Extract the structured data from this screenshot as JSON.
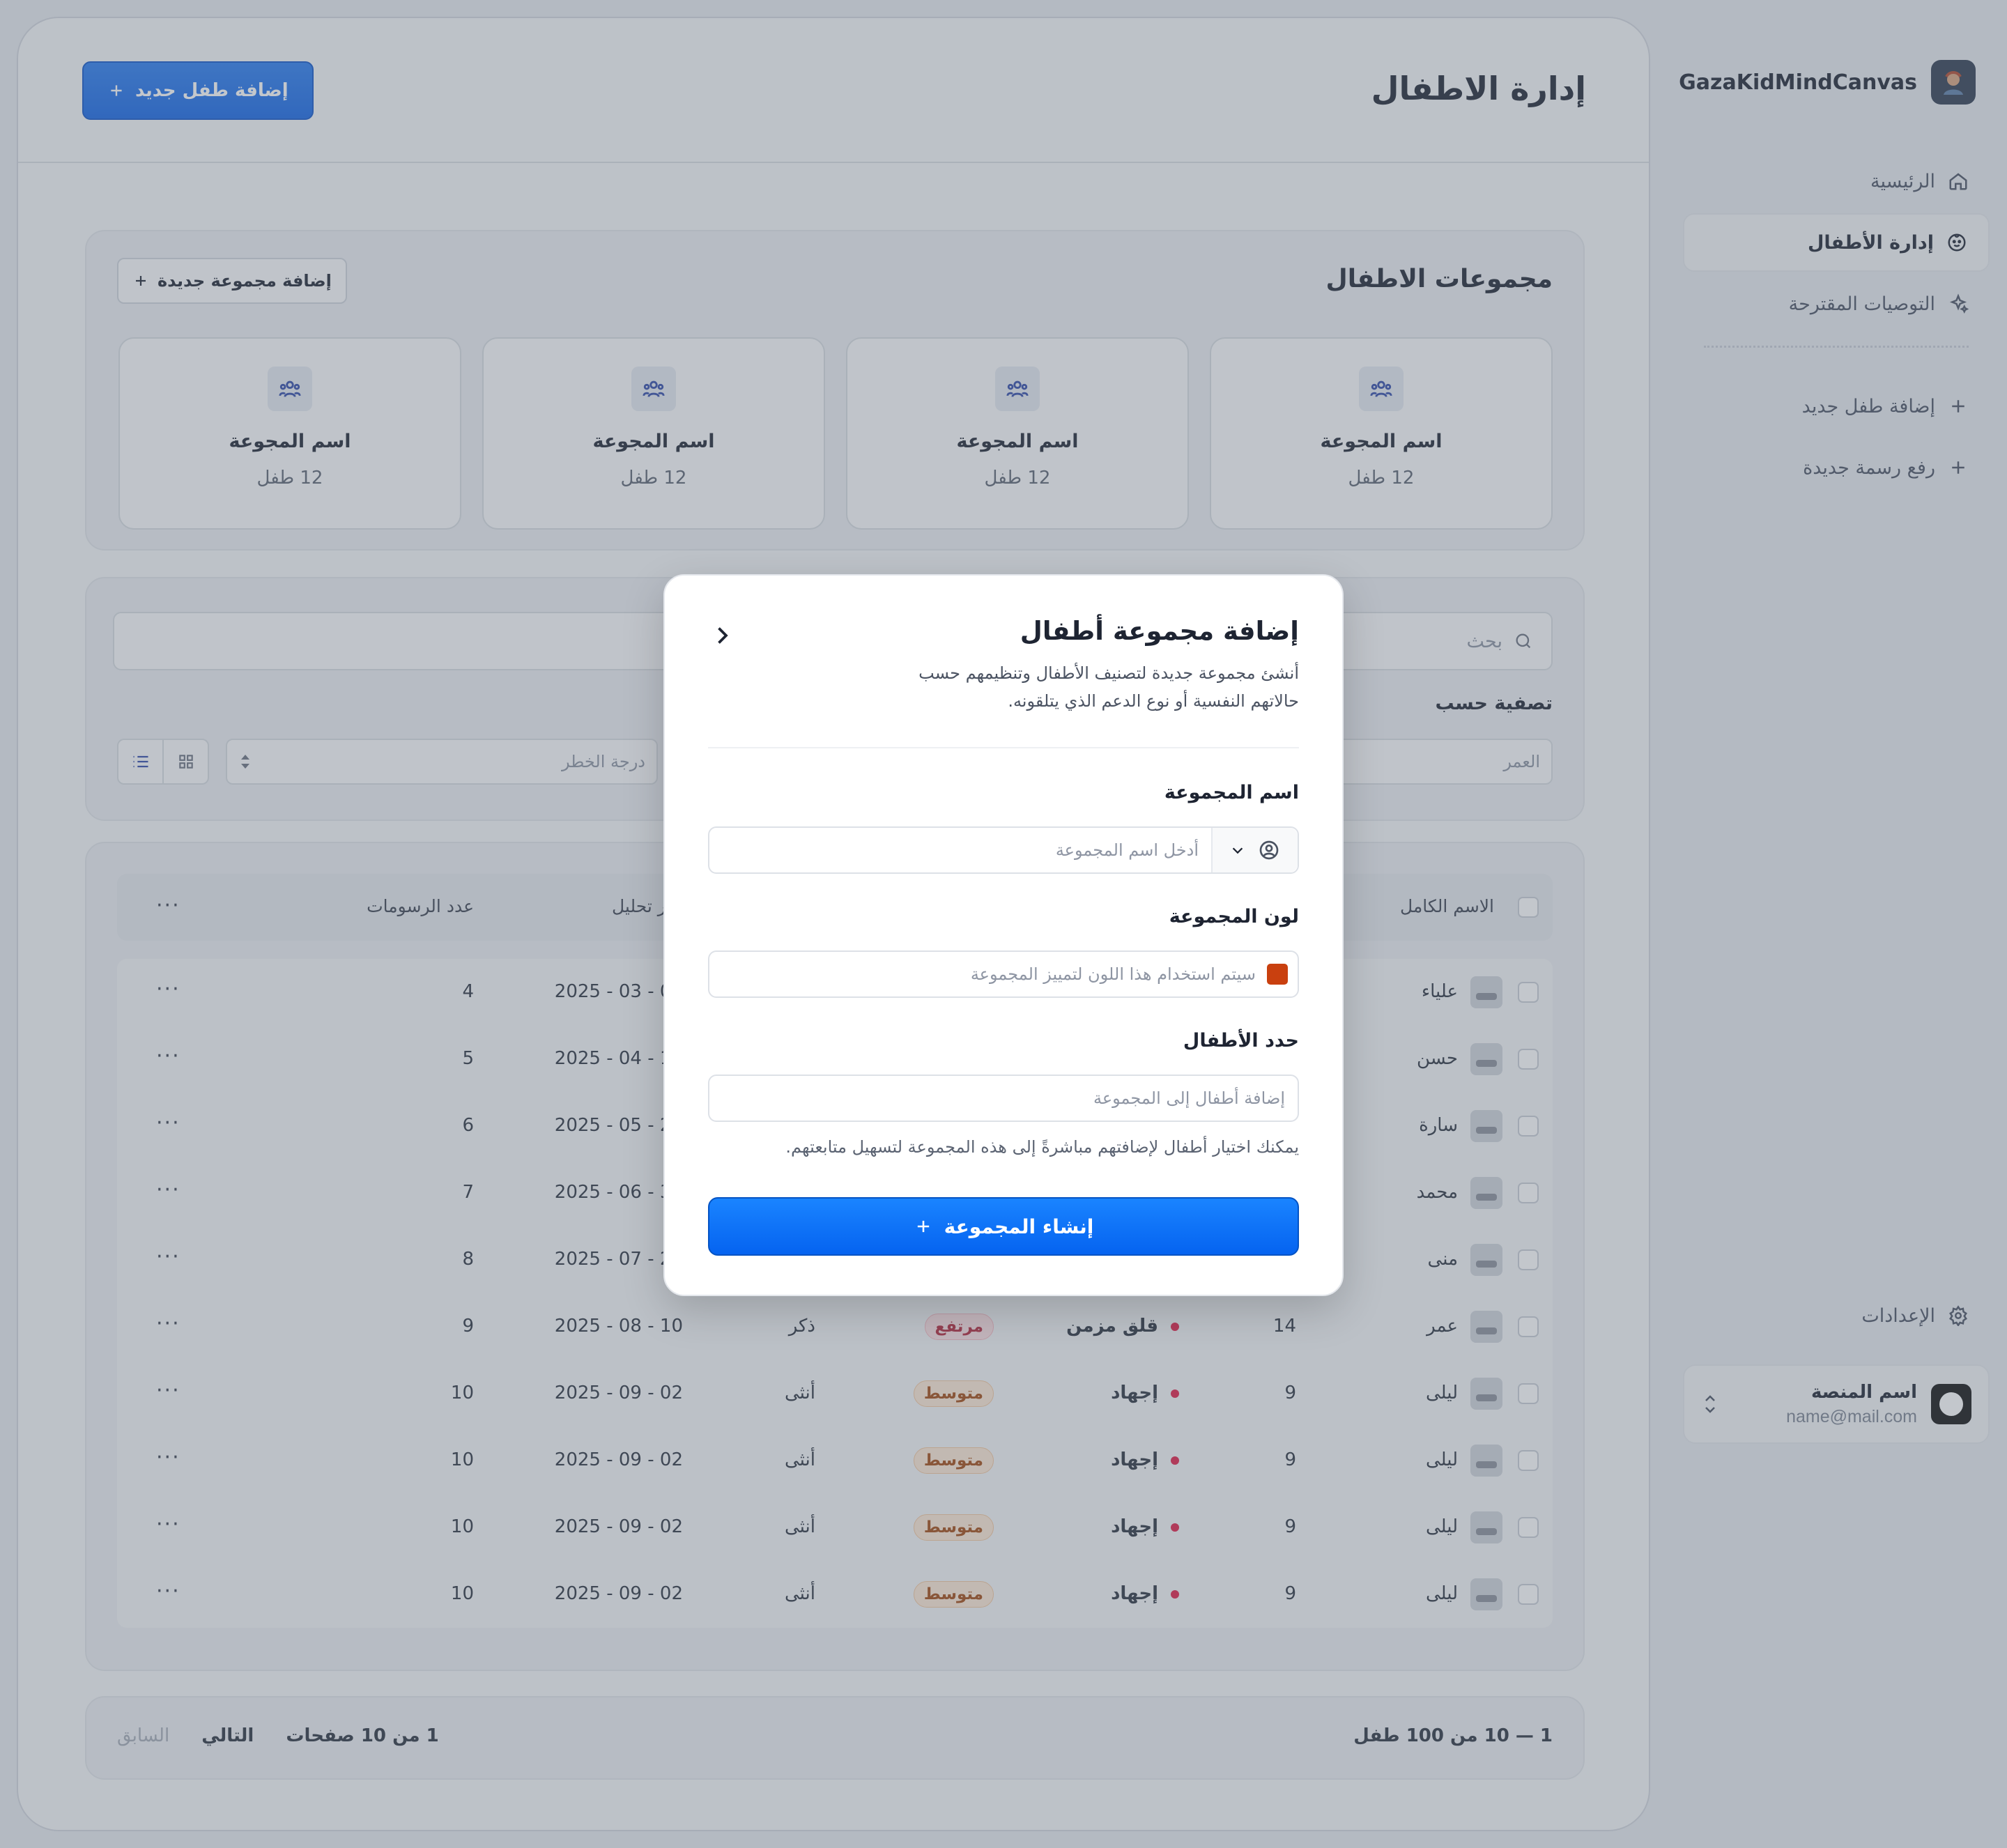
{
  "brand": {
    "name": "GazaKidMindCanvas"
  },
  "nav": {
    "items": [
      {
        "label": "الرئيسية",
        "icon": "home-icon",
        "active": false
      },
      {
        "label": "إدارة الأطفال",
        "icon": "child-face-icon",
        "active": true
      },
      {
        "label": "التوصيات المقترحة",
        "icon": "sparkles-icon",
        "active": false
      }
    ],
    "actions": [
      {
        "label": "إضافة طفل جديد",
        "icon": "plus-icon"
      },
      {
        "label": "رفع رسمة جديدة",
        "icon": "plus-icon"
      }
    ],
    "settings_label": "الإعدادات"
  },
  "user": {
    "name": "اسم المنصة",
    "email": "name@mail.com"
  },
  "header": {
    "title": "إدارة الاطفال",
    "add_child_label": "إضافة طفل جديد"
  },
  "groups": {
    "title": "مجموعات الاطفال",
    "add_label": "إضافة مجموعة جديدة",
    "cards": [
      {
        "name": "اسم المجوعة",
        "count": "12 طفل"
      },
      {
        "name": "اسم المجوعة",
        "count": "12 طفل"
      },
      {
        "name": "اسم المجوعة",
        "count": "12 طفل"
      },
      {
        "name": "اسم المجوعة",
        "count": "12 طفل"
      }
    ]
  },
  "filters": {
    "search_placeholder": "بحث",
    "filter_label": "تصفية حسب",
    "age_placeholder": "العمر",
    "risk_placeholder": "درجة الخطر"
  },
  "table": {
    "headers": {
      "name": "الاسم الكامل",
      "last_analysis": "آخر تحليل",
      "drawings": "عدد الرسومات"
    },
    "rows": [
      {
        "name": "علياء",
        "age": "",
        "condition": "",
        "risk": "",
        "risk_level": "",
        "gender": "",
        "date": "01 - 03 - 2025",
        "drawings": "4"
      },
      {
        "name": "حسن",
        "age": "",
        "condition": "",
        "risk": "",
        "risk_level": "",
        "gender": "",
        "date": "15 - 04 - 2025",
        "drawings": "5"
      },
      {
        "name": "سارة",
        "age": "",
        "condition": "",
        "risk": "",
        "risk_level": "",
        "gender": "",
        "date": "20 - 05 - 2025",
        "drawings": "6"
      },
      {
        "name": "محمد",
        "age": "",
        "condition": "",
        "risk": "",
        "risk_level": "",
        "gender": "",
        "date": "30 - 06 - 2025",
        "drawings": "7"
      },
      {
        "name": "منى",
        "age": "",
        "condition": "",
        "risk": "",
        "risk_level": "",
        "gender": "",
        "date": "25 - 07 - 2025",
        "drawings": "8"
      },
      {
        "name": "عمر",
        "age": "14",
        "condition": "قلق مزمن",
        "risk": "مرتفع",
        "risk_level": "high",
        "gender": "ذكر",
        "date": "10 - 08 - 2025",
        "drawings": "9"
      },
      {
        "name": "ليلى",
        "age": "9",
        "condition": "إجهاد",
        "risk": "متوسط",
        "risk_level": "mid",
        "gender": "أنثى",
        "date": "02 - 09 - 2025",
        "drawings": "10"
      },
      {
        "name": "ليلى",
        "age": "9",
        "condition": "إجهاد",
        "risk": "متوسط",
        "risk_level": "mid",
        "gender": "أنثى",
        "date": "02 - 09 - 2025",
        "drawings": "10"
      },
      {
        "name": "ليلى",
        "age": "9",
        "condition": "إجهاد",
        "risk": "متوسط",
        "risk_level": "mid",
        "gender": "أنثى",
        "date": "02 - 09 - 2025",
        "drawings": "10"
      },
      {
        "name": "ليلى",
        "age": "9",
        "condition": "إجهاد",
        "risk": "متوسط",
        "risk_level": "mid",
        "gender": "أنثى",
        "date": "02 - 09 - 2025",
        "drawings": "10"
      }
    ],
    "row_menu": "···"
  },
  "pagination": {
    "range": "1 — 10 من 100 طفل",
    "pages": "1 من 10 صفحات",
    "next": "التالي",
    "prev": "السابق"
  },
  "modal": {
    "title": "إضافة مجموعة أطفال",
    "description": "أنشئ مجموعة جديدة لتصنيف الأطفال وتنظيمهم حسب حالاتهم النفسية أو نوع الدعم الذي يتلقونه.",
    "name_label": "اسم المجموعة",
    "name_placeholder": "أدخل اسم المجموعة",
    "color_label": "لون المجموعة",
    "color_value": "#c9400f",
    "color_hint": "سيتم استخدام هذا اللون لتمييز المجموعة",
    "children_label": "حدد الأطفال",
    "children_placeholder": "إضافة أطفال إلى المجموعة",
    "children_hint": "يمكنك اختيار أطفال لإضافتهم مباشرةً إلى هذه المجموعة لتسهيل متابعتهم.",
    "submit_label": "إنشاء المجموعة"
  }
}
